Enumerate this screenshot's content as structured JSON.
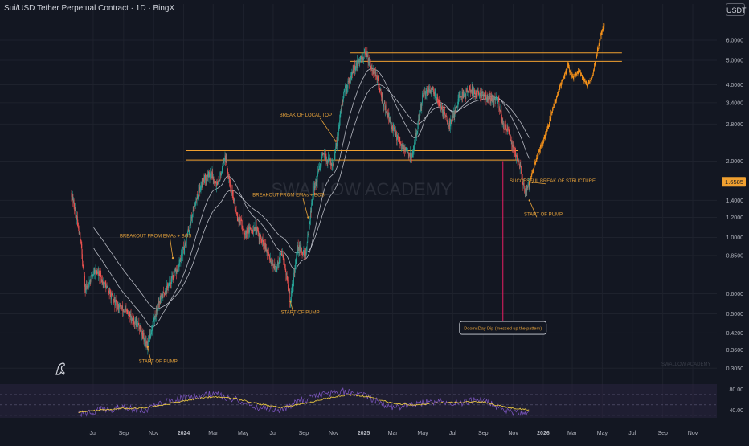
{
  "header": {
    "symbol_title": "Sui/USD Tether Perpetual Contract · 1D · BingX",
    "currency": "USDT"
  },
  "watermark": "SWALLOW ACADEMY",
  "corner_watermark": "SWALLOW ACADEMY",
  "colors": {
    "background": "#131722",
    "grid": "#1e222d",
    "up_candle": "#26a69a",
    "down_candle": "#ef5350",
    "projection": "#f7931a",
    "level_line": "#f0a030",
    "annotation": "#e8a33a",
    "ema": "#d1d4dc",
    "rsi_line": "#7e57c2",
    "rsi_ma": "#f5d142",
    "rsi_band": "#2a2440",
    "price_badge": "#f0a030"
  },
  "chart_data": [
    {
      "type": "candlestick",
      "y_scale": "log",
      "ylim": [
        0.28,
        7.2
      ],
      "x_ticks": [
        "Jul",
        "Sep",
        "Nov",
        "2024",
        "Mar",
        "May",
        "Jul",
        "Sep",
        "Nov",
        "2025",
        "Mar",
        "May",
        "Jul",
        "Sep",
        "Nov",
        "2026",
        "Mar",
        "May",
        "Jul",
        "Sep",
        "Nov"
      ],
      "y_ticks": [
        "6.0000",
        "5.0000",
        "4.0000",
        "3.4000",
        "2.8000",
        "2.0000",
        "1.4000",
        "1.2000",
        "1.0000",
        "0.8500",
        "0.6000",
        "0.5000",
        "0.4200",
        "0.3600",
        "0.3050"
      ],
      "current_price": "1.6585",
      "price_path": [
        [
          "2023-05-18",
          1.5
        ],
        [
          "2023-06-05",
          1.0
        ],
        [
          "2023-06-15",
          0.62
        ],
        [
          "2023-07-05",
          0.75
        ],
        [
          "2023-07-25",
          0.65
        ],
        [
          "2023-08-15",
          0.55
        ],
        [
          "2023-09-10",
          0.5
        ],
        [
          "2023-10-05",
          0.44
        ],
        [
          "2023-10-19",
          0.37
        ],
        [
          "2023-11-10",
          0.55
        ],
        [
          "2023-12-01",
          0.65
        ],
        [
          "2023-12-20",
          0.75
        ],
        [
          "2024-01-10",
          1.05
        ],
        [
          "2024-01-25",
          1.4
        ],
        [
          "2024-02-10",
          1.7
        ],
        [
          "2024-02-25",
          1.8
        ],
        [
          "2024-03-10",
          1.6
        ],
        [
          "2024-03-25",
          2.1
        ],
        [
          "2024-04-10",
          1.45
        ],
        [
          "2024-04-20",
          1.2
        ],
        [
          "2024-05-05",
          1.05
        ],
        [
          "2024-05-25",
          1.1
        ],
        [
          "2024-06-10",
          0.95
        ],
        [
          "2024-07-05",
          0.75
        ],
        [
          "2024-07-20",
          0.88
        ],
        [
          "2024-08-05",
          0.56
        ],
        [
          "2024-08-20",
          0.92
        ],
        [
          "2024-09-05",
          0.85
        ],
        [
          "2024-09-20",
          1.5
        ],
        [
          "2024-10-10",
          2.1
        ],
        [
          "2024-11-01",
          1.95
        ],
        [
          "2024-11-20",
          3.6
        ],
        [
          "2024-12-10",
          4.6
        ],
        [
          "2025-01-05",
          5.3
        ],
        [
          "2025-01-25",
          4.4
        ],
        [
          "2025-02-10",
          3.4
        ],
        [
          "2025-02-28",
          2.7
        ],
        [
          "2025-03-20",
          2.25
        ],
        [
          "2025-04-10",
          2.1
        ],
        [
          "2025-05-01",
          3.6
        ],
        [
          "2025-05-20",
          3.9
        ],
        [
          "2025-06-10",
          3.2
        ],
        [
          "2025-06-25",
          2.75
        ],
        [
          "2025-07-15",
          3.6
        ],
        [
          "2025-08-05",
          3.8
        ],
        [
          "2025-08-25",
          3.7
        ],
        [
          "2025-09-15",
          3.5
        ],
        [
          "2025-10-01",
          3.5
        ],
        [
          "2025-10-11",
          2.8
        ],
        [
          "2025-10-25",
          2.5
        ],
        [
          "2025-11-15",
          1.9
        ],
        [
          "2025-11-25",
          1.5
        ],
        [
          "2025-12-04",
          1.6585
        ]
      ],
      "projection_path": [
        [
          "2025-12-04",
          1.6585
        ],
        [
          "2025-12-20",
          2.1
        ],
        [
          "2026-01-05",
          2.5
        ],
        [
          "2026-01-20",
          3.2
        ],
        [
          "2026-02-05",
          4.0
        ],
        [
          "2026-02-20",
          4.8
        ],
        [
          "2026-03-01",
          4.3
        ],
        [
          "2026-03-15",
          4.5
        ],
        [
          "2026-04-01",
          4.0
        ],
        [
          "2026-04-10",
          4.3
        ],
        [
          "2026-04-20",
          5.3
        ],
        [
          "2026-04-28",
          6.3
        ],
        [
          "2026-05-05",
          7.0
        ]
      ],
      "horizontal_levels": [
        {
          "price": 5.35,
          "from": "2024-12-05",
          "to": "2026-06-10"
        },
        {
          "price": 4.95,
          "from": "2024-12-05",
          "to": "2026-06-10"
        },
        {
          "price": 2.2,
          "from": "2024-01-05",
          "to": "2025-11-10"
        },
        {
          "price": 2.02,
          "from": "2024-01-05",
          "to": "2025-11-10"
        }
      ],
      "annotations": [
        {
          "text": "BREAK OF LOCAL TOP",
          "at": [
            "2024-11-05",
            2.4
          ],
          "label_at": [
            "2024-09-05",
            3.0
          ]
        },
        {
          "text": "BREAKOUT FROM EMAs + BOS",
          "at": [
            "2024-09-10",
            1.2
          ],
          "label_at": [
            "2024-08-01",
            1.45
          ]
        },
        {
          "text": "BREAKOUT FROM EMAs + BOS",
          "at": [
            "2023-12-10",
            0.83
          ],
          "label_at": [
            "2023-11-05",
            1.0
          ]
        },
        {
          "text": "START OF PUMP",
          "at": [
            "2023-10-20",
            0.37
          ],
          "label_at": [
            "2023-11-10",
            0.32
          ]
        },
        {
          "text": "START OF PUMP",
          "at": [
            "2024-08-05",
            0.56
          ],
          "label_at": [
            "2024-08-25",
            0.5
          ]
        },
        {
          "text": "START OF PUMP",
          "at": [
            "2025-12-04",
            1.4
          ],
          "label_at": [
            "2026-01-01",
            1.22
          ]
        },
        {
          "text": "SUCCESFUL BREAK OF STRUCTURE",
          "at": [
            "2025-12-10",
            1.65
          ],
          "label_at": [
            "2026-01-20",
            1.65
          ]
        }
      ],
      "callout": {
        "text": "DoomsDay Dip (messed up the pattern)",
        "at": [
          "2025-10-11",
          0.44
        ],
        "line_from": [
          "2025-10-11",
          2.0
        ]
      }
    },
    {
      "type": "line",
      "name": "RSI",
      "ylim": [
        25,
        90
      ],
      "y_ticks": [
        "80.00",
        "40.00"
      ],
      "bands": [
        70,
        50,
        30
      ],
      "x": [
        "2023-06-01",
        "2023-07-15",
        "2023-09-01",
        "2023-10-15",
        "2023-12-01",
        "2024-01-15",
        "2024-03-01",
        "2024-04-15",
        "2024-06-01",
        "2024-07-15",
        "2024-09-01",
        "2024-10-15",
        "2024-12-01",
        "2025-01-15",
        "2025-03-01",
        "2025-04-15",
        "2025-06-01",
        "2025-07-15",
        "2025-09-01",
        "2025-10-15",
        "2025-12-04"
      ],
      "y": [
        32,
        40,
        45,
        40,
        58,
        65,
        72,
        60,
        45,
        40,
        60,
        70,
        78,
        62,
        45,
        50,
        58,
        54,
        60,
        38,
        34
      ],
      "ma": [
        36,
        40,
        43,
        44,
        52,
        60,
        66,
        62,
        52,
        45,
        52,
        62,
        70,
        65,
        53,
        50,
        54,
        55,
        56,
        46,
        40
      ]
    }
  ]
}
